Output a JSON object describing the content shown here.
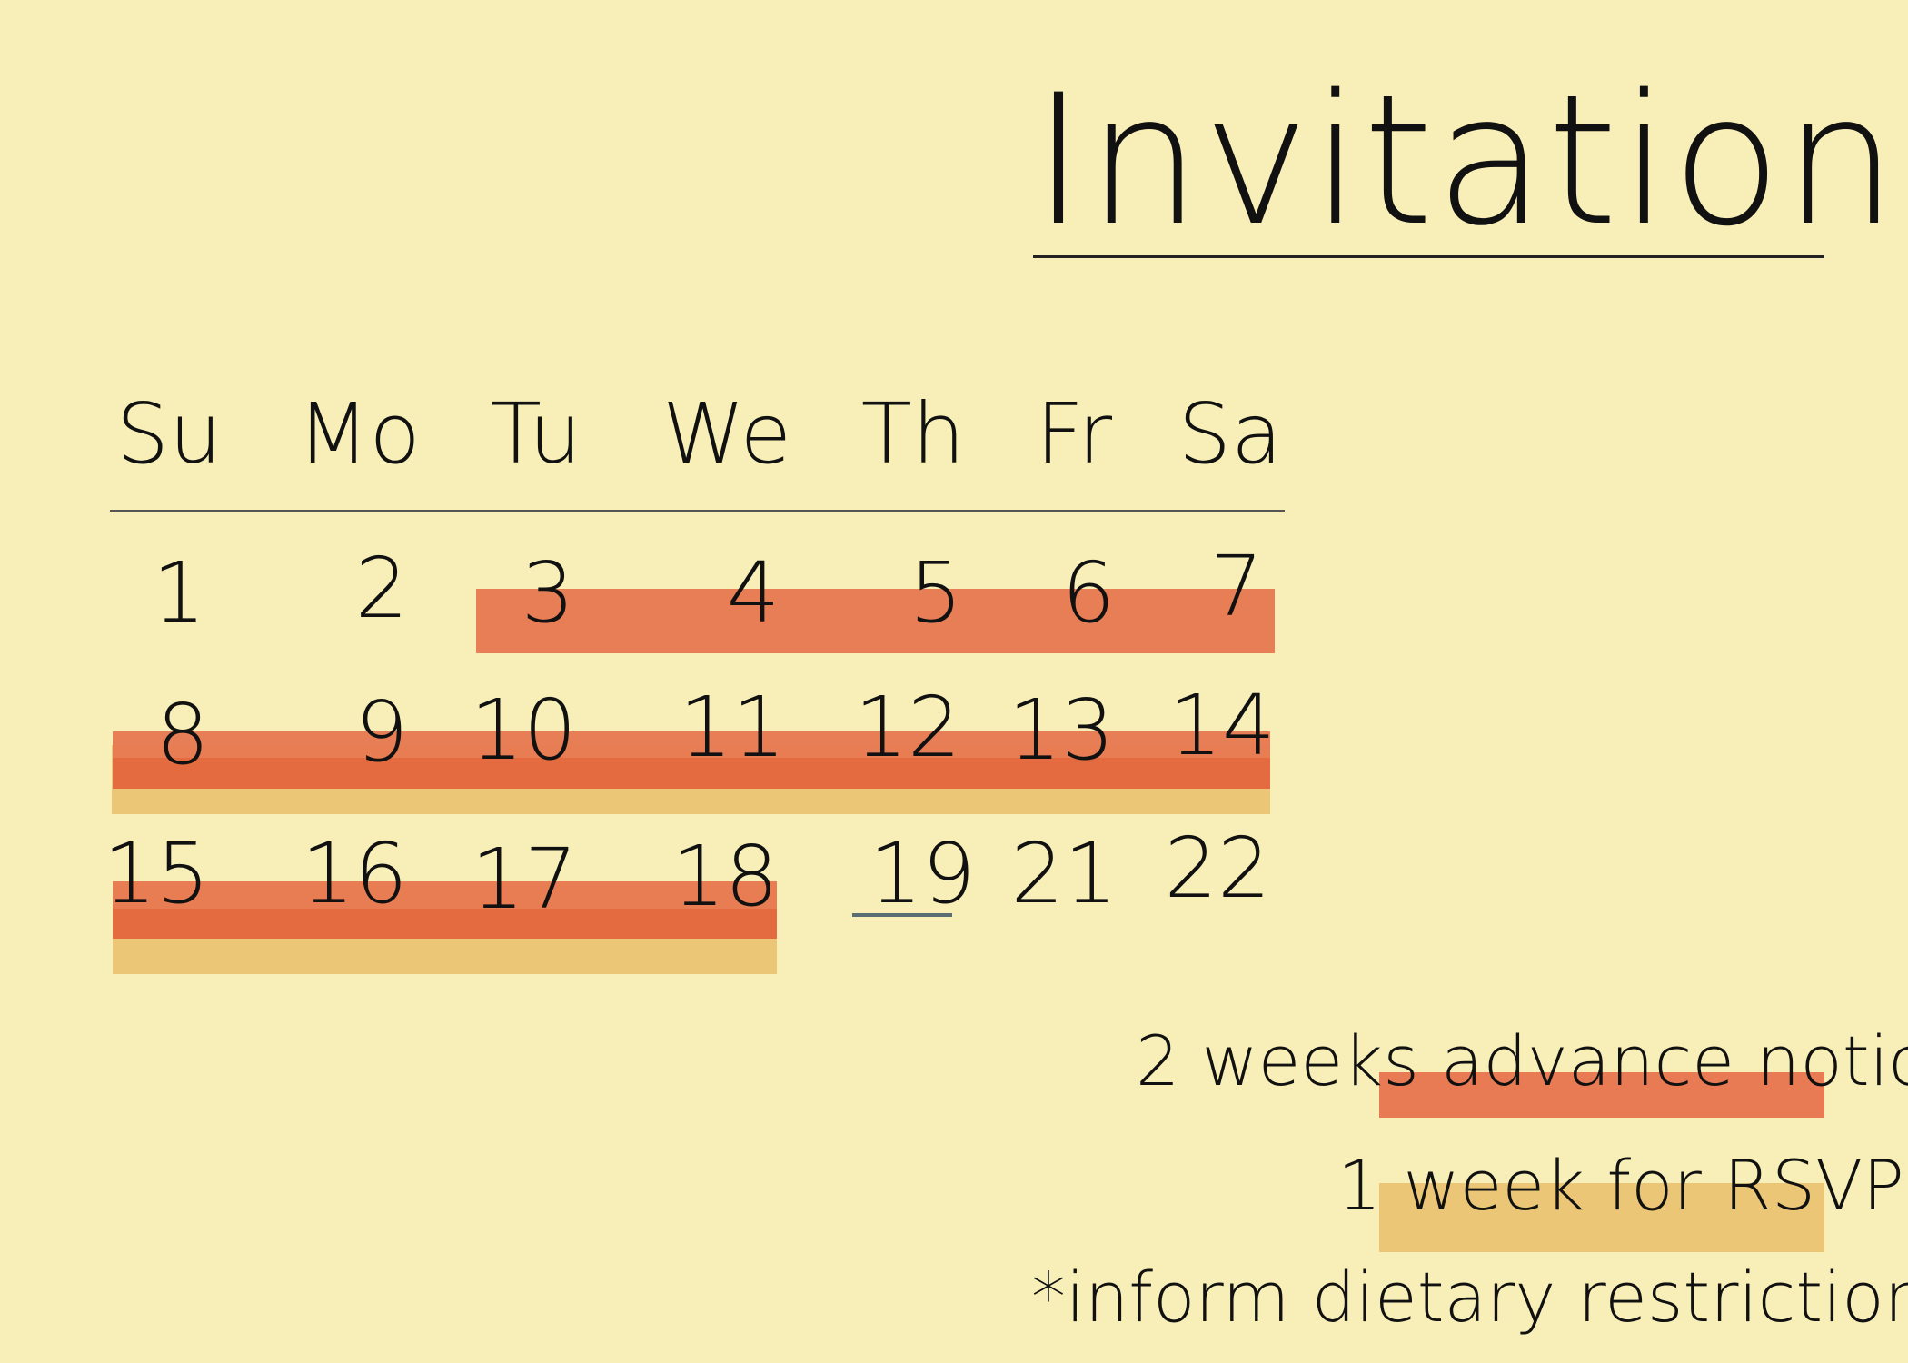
{
  "title": "Invitations",
  "weekdays": [
    "Su",
    "Mo",
    "Tu",
    "We",
    "Th",
    "Fr",
    "Sa"
  ],
  "weeks": [
    [
      "1",
      "2",
      "3",
      "4",
      "5",
      "6",
      "7"
    ],
    [
      "8",
      "9",
      "10",
      "11",
      "12",
      "13",
      "14"
    ],
    [
      "15",
      "16",
      "17",
      "18",
      "19",
      "21",
      "22"
    ]
  ],
  "highlight_colors": {
    "advance_notice": "#e87b54",
    "rsvp": "#eac676",
    "underline": "#5a6c74"
  },
  "legend": {
    "line1_prefix": "2 weeks ",
    "line1_highlight": "advance notice",
    "line2_prefix": "1 ",
    "line2_highlight": "week for RSVP",
    "line3": "*inform dietary restrictions"
  }
}
